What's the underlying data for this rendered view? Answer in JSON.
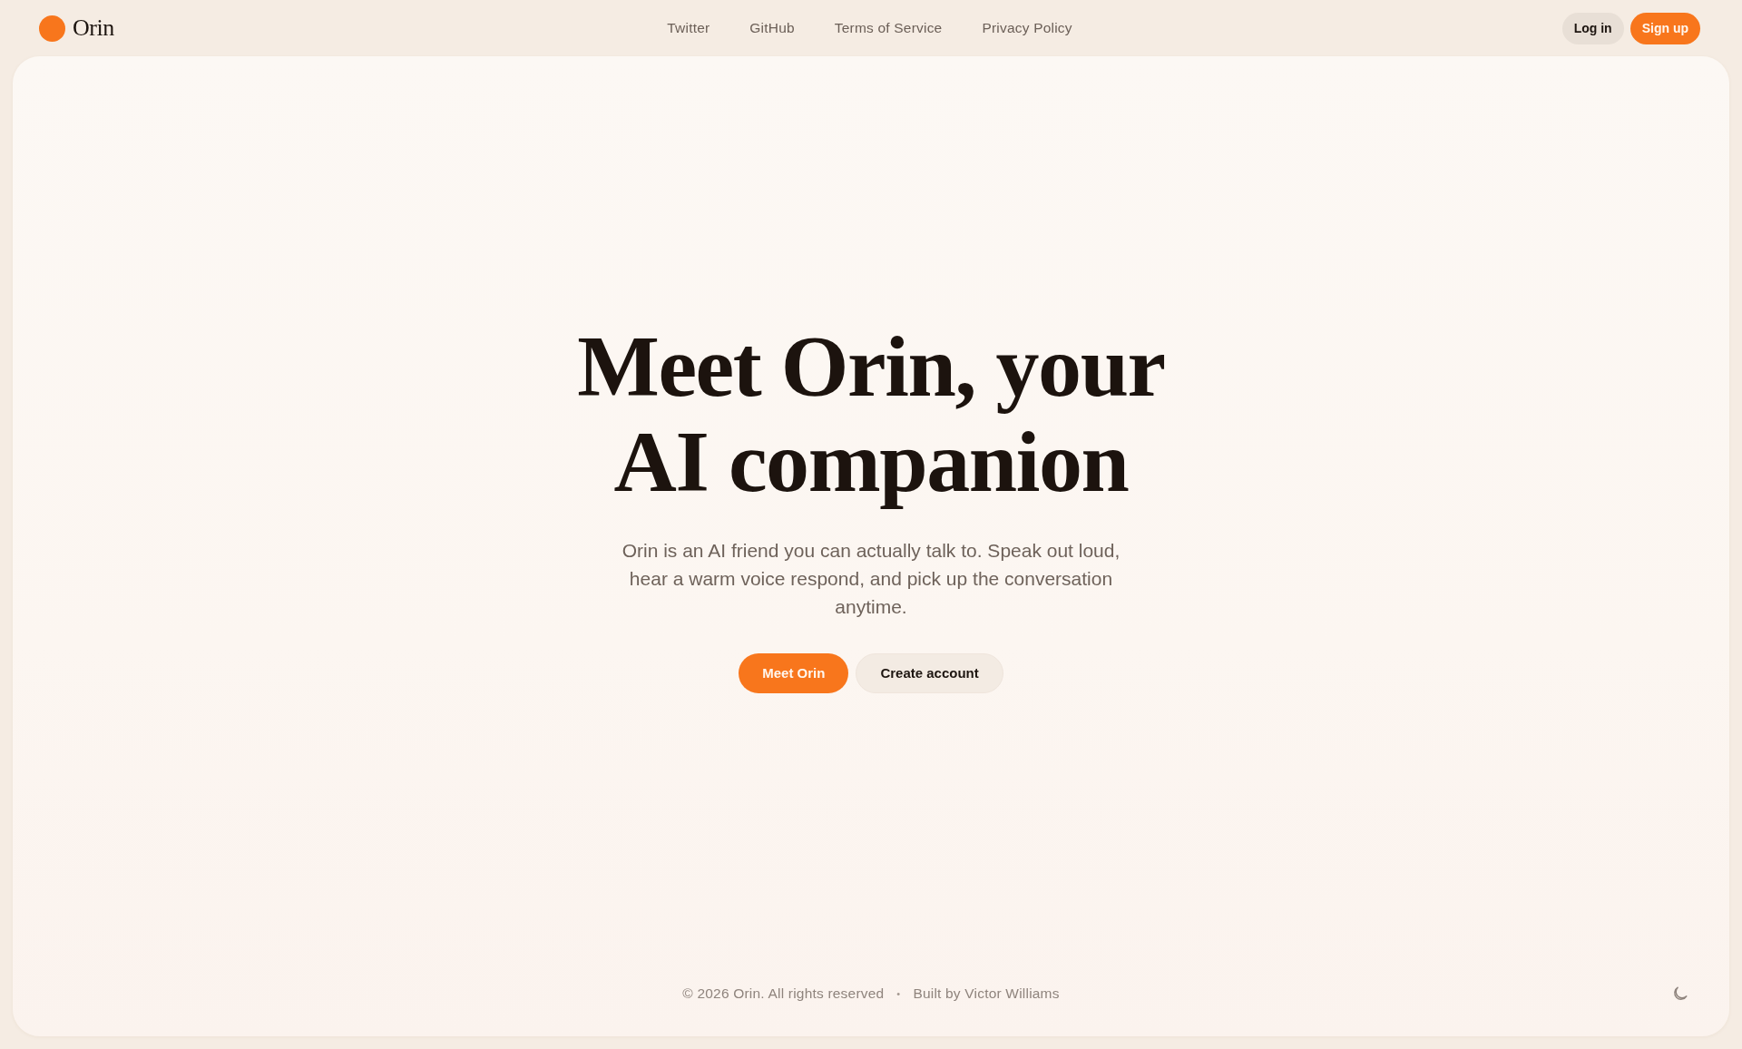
{
  "header": {
    "logo": {
      "text": "Orin"
    },
    "nav_links": [
      "Twitter",
      "GitHub",
      "Terms of Service",
      "Privacy Policy"
    ],
    "buttons": [
      {
        "label": "Log in",
        "kind": "secondary"
      },
      {
        "label": "Sign up",
        "kind": "primary"
      }
    ]
  },
  "hero": {
    "title_lines": [
      "Meet Orin, your",
      "AI companion"
    ],
    "description": "Orin is an AI friend you can actually talk to. Speak out loud, hear a warm voice respond, and pick up the conversation anytime.",
    "buttons": [
      {
        "label": "Meet Orin",
        "kind": "primary"
      },
      {
        "label": "Create account",
        "kind": "secondary"
      }
    ]
  },
  "footer": {
    "copyright": "© 2026 Orin. All rights reserved",
    "separator": "•",
    "credit": "Built by Victor Williams"
  }
}
